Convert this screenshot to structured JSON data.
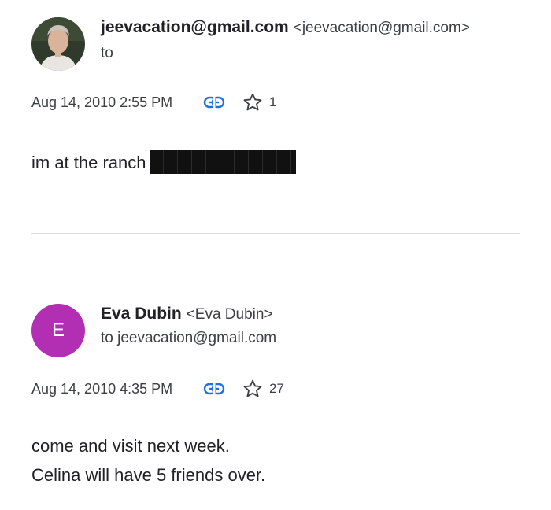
{
  "messages": [
    {
      "sender_name": "jeevacation@gmail.com",
      "sender_email": "<jeevacation@gmail.com>",
      "recipient": "to",
      "timestamp": "Aug 14, 2010 2:55 PM",
      "star_count": "1",
      "avatar": {
        "type": "photo"
      },
      "body": [
        "im at the ranch"
      ],
      "has_redaction": true
    },
    {
      "sender_name": "Eva Dubin",
      "sender_email": "<Eva Dubin>",
      "recipient": "to jeevacation@gmail.com",
      "timestamp": "Aug 14, 2010 4:35 PM",
      "star_count": "27",
      "avatar": {
        "type": "letter",
        "letter": "E",
        "color": "#b22fb4"
      },
      "body": [
        "come and visit next week.",
        "Celina will have 5 friends over."
      ]
    }
  ],
  "icons": {
    "link": "link-icon",
    "star": "star-outline-icon"
  },
  "colors": {
    "link_icon": "#1a73e8",
    "avatar_e": "#b22fb4",
    "divider": "#dadce0",
    "redaction": "#111111"
  }
}
